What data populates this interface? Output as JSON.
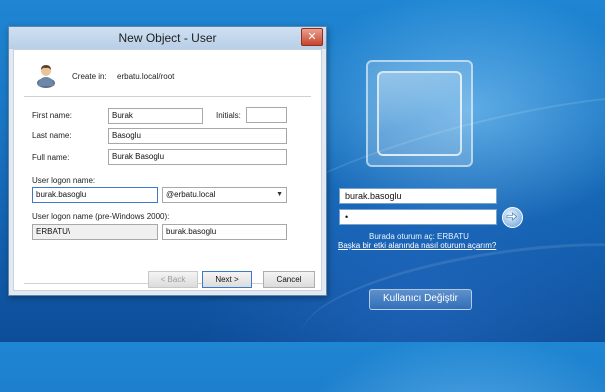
{
  "dialog": {
    "title": "New Object - User",
    "close_label": "✕",
    "create_in_label": "Create in:",
    "create_in_value": "erbatu.local/root",
    "first_name_label": "First name:",
    "first_name_value": "Burak",
    "initials_label": "Initials:",
    "initials_value": "",
    "last_name_label": "Last name:",
    "last_name_value": "Basoglu",
    "full_name_label": "Full name:",
    "full_name_value": "Burak Basoglu",
    "logon_name_label": "User logon name:",
    "logon_name_value": "burak.basoglu",
    "domain_value": "@erbatu.local",
    "pre2000_label": "User logon name (pre-Windows 2000):",
    "pre2000_domain_value": "ERBATU\\",
    "pre2000_name_value": "burak.basoglu",
    "buttons": {
      "back": "< Back",
      "next": "Next >",
      "cancel": "Cancel"
    }
  },
  "logon": {
    "username_value": "burak.basoglu",
    "password_value": "•",
    "signin_on_text": "Burada oturum aç: ERBATU",
    "other_domain_link": "Başka bir etki alanında nasıl oturum açarım?",
    "switch_user_label": "Kullanıcı Değiştir"
  },
  "colors": {
    "desktop_blue": "#1a76c4",
    "dialog_titlebar": "#cfe0f2",
    "focus_border": "#3b7ac7"
  }
}
